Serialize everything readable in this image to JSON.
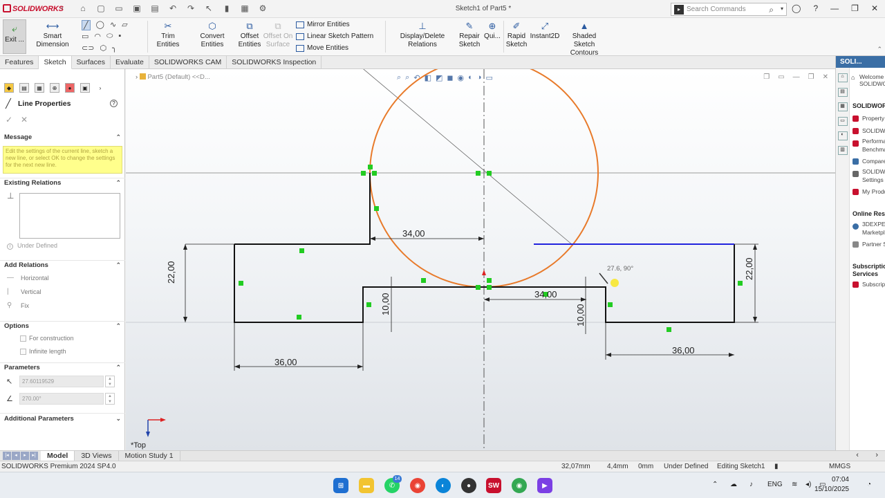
{
  "titlebar": {
    "brand": "SOLIDWORKS",
    "doc_title": "Sketch1 of Part5 *",
    "search_placeholder": "Search Commands"
  },
  "cmdbar": {
    "exit": "Exit ...",
    "smart_dimension": "Smart Dimension",
    "trim": "Trim Entities",
    "convert": "Convert Entities",
    "offset": [
      "Offset",
      "Entities"
    ],
    "offset_surface": [
      "Offset On",
      "Surface"
    ],
    "mirror": "Mirror Entities",
    "linear_pattern": "Linear Sketch Pattern",
    "move": "Move Entities",
    "display_delete": "Display/Delete Relations",
    "repair": [
      "Repair",
      "Sketch"
    ],
    "quick": "Qui...",
    "rapid": [
      "Rapid",
      "Sketch"
    ],
    "instant2d": "Instant2D",
    "shaded": [
      "Shaded Sketch",
      "Contours"
    ]
  },
  "tabs": [
    "Features",
    "Sketch",
    "Surfaces",
    "Evaluate",
    "SOLIDWORKS CAM",
    "SOLIDWORKS Inspection"
  ],
  "active_tab": "Sketch",
  "pm": {
    "title": "Line Properties",
    "message_head": "Message",
    "message": "Edit the settings of the current line, sketch a new line, or select OK to change the settings for the next new line.",
    "existing_relations": "Existing Relations",
    "under_defined": "Under Defined",
    "add_relations": "Add Relations",
    "horizontal": "Horizontal",
    "vertical": "Vertical",
    "fix": "Fix",
    "options": "Options",
    "for_construction": "For construction",
    "infinite_length": "Infinite length",
    "parameters": "Parameters",
    "length_value": "27.60119529",
    "angle_value": "270.00°",
    "additional_parameters": "Additional Parameters"
  },
  "graphics": {
    "tree_label": "Part5 (Default) <<D...",
    "view_label": "*Top",
    "cursor_readout": "27.6, 90°",
    "dimensions": {
      "d_top_34": "34,00",
      "d_mid_34": "34,00",
      "d_left_36": "36,00",
      "d_right_36": "36,00",
      "d_left_22": "22,00",
      "d_right_22": "22,00",
      "d_left_10": "10,00",
      "d_right_10": "10,00"
    }
  },
  "rightpanel": {
    "header": "SOLI...",
    "welcome": [
      "Welcome to",
      "SOLIDWORKS"
    ],
    "section1": "SOLIDWORKS",
    "items1": [
      "Property Tab",
      "SOLIDWORKS",
      "Performance",
      "Benchmark",
      "Compare M...",
      "SOLIDWORKS",
      "Settings Wi...",
      "My Product"
    ],
    "section2": "Online Resour...",
    "items2": [
      "3DEXPERIENCE",
      "Marketplace",
      "Partner Solu..."
    ],
    "section3": [
      "Subscription",
      "Services"
    ],
    "items3": [
      "Subscription"
    ]
  },
  "bottomtabs": [
    "Model",
    "3D Views",
    "Motion Study 1"
  ],
  "active_bottom": "Model",
  "status": {
    "product": "SOLIDWORKS Premium 2024 SP4.0",
    "x": "32,07mm",
    "y": "4,4mm",
    "z": "0mm",
    "state": "Under Defined",
    "editing": "Editing Sketch1",
    "units": "MMGS"
  },
  "taskbar": {
    "whatsapp_badge": "14",
    "lang": "ENG",
    "time": "07:04",
    "date": "15/10/2025"
  },
  "colors": {
    "sketch_circle": "#e87a2a",
    "sketch_line": "#111111",
    "selected_line": "#2222dd",
    "point": "#22cc22",
    "brand": "#c8102e"
  }
}
